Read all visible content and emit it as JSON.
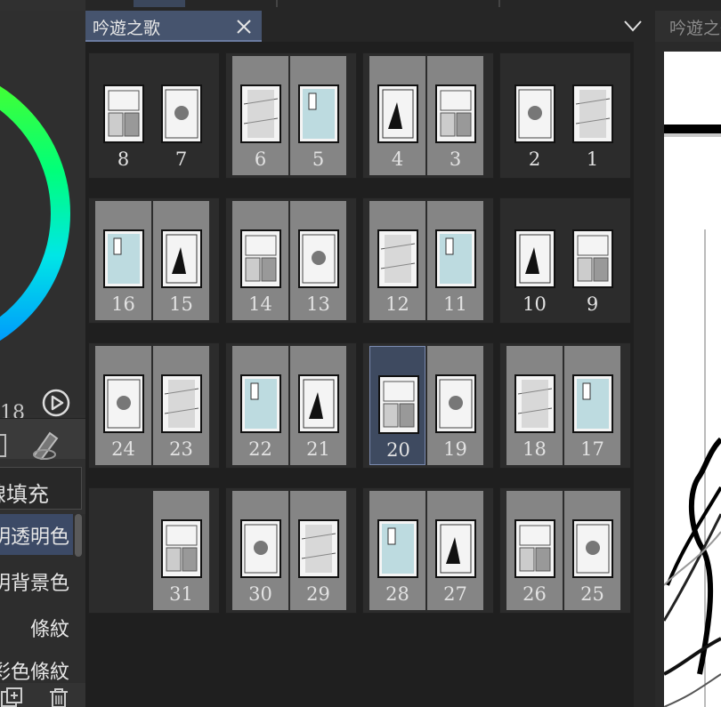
{
  "app": {
    "document_title": "吟遊之歌",
    "canvas_tab_title": "吟遊之歌"
  },
  "left_panel": {
    "frame_counter": "18",
    "fill_mode_label": "線填充",
    "fill_options": [
      {
        "label": "明透明色",
        "selected": true
      },
      {
        "label": "明背景色",
        "selected": false
      },
      {
        "label": "條紋",
        "selected": false
      },
      {
        "label": "彩色條紋",
        "selected": false
      }
    ]
  },
  "icons": {
    "tab_close": "close-icon",
    "tab_menu": "chevron-down-icon",
    "play": "play-icon",
    "add_layer": "add-layer-icon",
    "trash": "trash-icon"
  },
  "colors": {
    "active_tab": "#46546e",
    "selected_page": "#3e4a60",
    "page_bg": "#858585",
    "panel_bg": "#1f1f1f"
  },
  "spreads": [
    {
      "row": 0,
      "col": 0,
      "left": {
        "num": "8",
        "bg": "dark"
      },
      "right": {
        "num": "7",
        "bg": "dark"
      }
    },
    {
      "row": 0,
      "col": 1,
      "left": {
        "num": "6",
        "bg": "grey"
      },
      "right": {
        "num": "5",
        "bg": "grey"
      }
    },
    {
      "row": 0,
      "col": 2,
      "left": {
        "num": "4",
        "bg": "grey"
      },
      "right": {
        "num": "3",
        "bg": "grey"
      }
    },
    {
      "row": 0,
      "col": 3,
      "left": {
        "num": "2",
        "bg": "dark"
      },
      "right": {
        "num": "1",
        "bg": "dark"
      }
    },
    {
      "row": 1,
      "col": 0,
      "left": {
        "num": "16",
        "bg": "grey"
      },
      "right": {
        "num": "15",
        "bg": "grey"
      }
    },
    {
      "row": 1,
      "col": 1,
      "left": {
        "num": "14",
        "bg": "grey"
      },
      "right": {
        "num": "13",
        "bg": "grey"
      }
    },
    {
      "row": 1,
      "col": 2,
      "left": {
        "num": "12",
        "bg": "grey"
      },
      "right": {
        "num": "11",
        "bg": "grey"
      }
    },
    {
      "row": 1,
      "col": 3,
      "left": {
        "num": "10",
        "bg": "dark"
      },
      "right": {
        "num": "9",
        "bg": "dark"
      }
    },
    {
      "row": 2,
      "col": 0,
      "left": {
        "num": "24",
        "bg": "grey"
      },
      "right": {
        "num": "23",
        "bg": "grey"
      }
    },
    {
      "row": 2,
      "col": 1,
      "left": {
        "num": "22",
        "bg": "grey"
      },
      "right": {
        "num": "21",
        "bg": "grey"
      }
    },
    {
      "row": 2,
      "col": 2,
      "left": {
        "num": "20",
        "bg": "active"
      },
      "right": {
        "num": "19",
        "bg": "grey"
      }
    },
    {
      "row": 2,
      "col": 3,
      "left": {
        "num": "18",
        "bg": "grey"
      },
      "right": {
        "num": "17",
        "bg": "grey"
      }
    },
    {
      "row": 3,
      "col": 0,
      "left": null,
      "right": {
        "num": "31",
        "bg": "grey"
      }
    },
    {
      "row": 3,
      "col": 1,
      "left": {
        "num": "30",
        "bg": "grey"
      },
      "right": {
        "num": "29",
        "bg": "grey"
      }
    },
    {
      "row": 3,
      "col": 2,
      "left": {
        "num": "28",
        "bg": "grey"
      },
      "right": {
        "num": "27",
        "bg": "grey"
      }
    },
    {
      "row": 3,
      "col": 3,
      "left": {
        "num": "26",
        "bg": "grey"
      },
      "right": {
        "num": "25",
        "bg": "grey"
      }
    }
  ]
}
